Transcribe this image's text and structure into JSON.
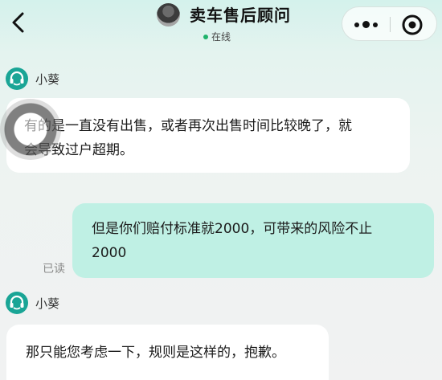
{
  "header": {
    "title": "卖车售后顾问",
    "status": "在线",
    "back_icon": "chevron-left-icon",
    "more_icon": "more-dots-icon",
    "close_icon": "target-close-icon"
  },
  "colors": {
    "accent": "#1fb26b",
    "outgoing_bubble": "#bff0e4",
    "incoming_bubble": "#ffffff",
    "header_gradient_top": "#d4f2ec"
  },
  "messages": [
    {
      "sender": "小葵",
      "direction": "in",
      "text_line1": "有的是一直没有出售，或者再次出售时间比较晚了，就",
      "text_line2": "会导致过户超期。"
    },
    {
      "direction": "out",
      "text_line1": "但是你们赔付标准就2000，可带来的风险不止",
      "text_line2": "2000",
      "read_status": "已读"
    },
    {
      "sender": "小葵",
      "direction": "in",
      "text_line1": "那只能您考虑一下，规则是这样的，抱歉。"
    }
  ]
}
